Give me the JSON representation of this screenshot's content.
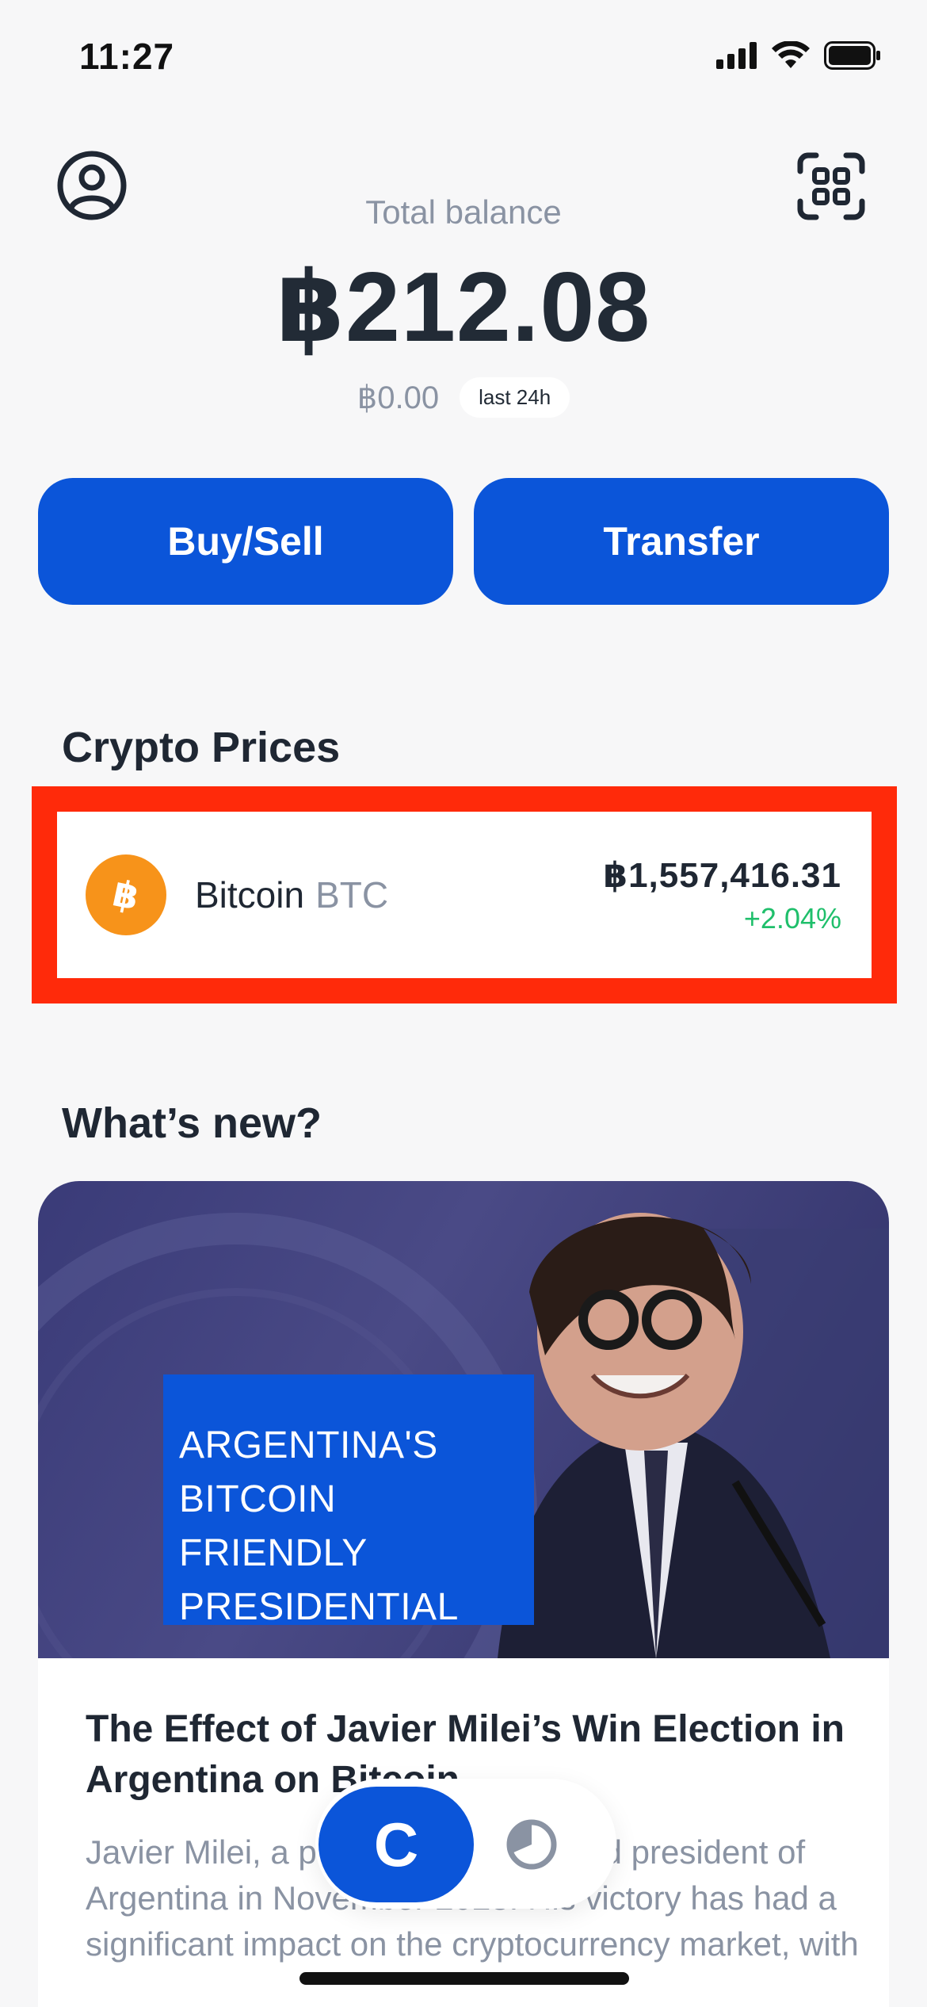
{
  "status_bar": {
    "time": "11:27",
    "icons": [
      "cellular-signal-icon",
      "wifi-icon",
      "battery-icon"
    ]
  },
  "header": {
    "profile_icon": "user-circle-icon",
    "scan_icon": "qr-scan-icon",
    "balance_label": "Total balance",
    "balance_value": "฿212.08",
    "change_value": "฿0.00",
    "change_period": "last 24h"
  },
  "actions": {
    "buy_sell": "Buy/Sell",
    "transfer": "Transfer"
  },
  "crypto": {
    "title": "Crypto Prices",
    "items": [
      {
        "name": "Bitcoin",
        "ticker": "BTC",
        "price": "฿1,557,416.31",
        "change": "+2.04%",
        "icon": "bitcoin-icon"
      }
    ]
  },
  "news": {
    "title": "What’s new?",
    "image_banner": [
      "ARGENTINA'S",
      "BITCOIN FRIENDLY",
      "PRESIDENTIAL"
    ],
    "headline": "The Effect of Javier Milei’s Win Election in Argentina on Bitcoin",
    "body": "Javier Milei, a politician, was elected president of Argentina in November 2023. His victory has had a significant impact on the cryptocurrency market, with"
  },
  "tabs": {
    "active_label": "C",
    "portfolio_icon": "pie-chart-icon"
  },
  "colors": {
    "primary": "#0b55d9",
    "highlight": "#ff2a0a",
    "positive": "#1fbf6b",
    "muted": "#8a93a3",
    "bitcoin": "#f7931a"
  }
}
